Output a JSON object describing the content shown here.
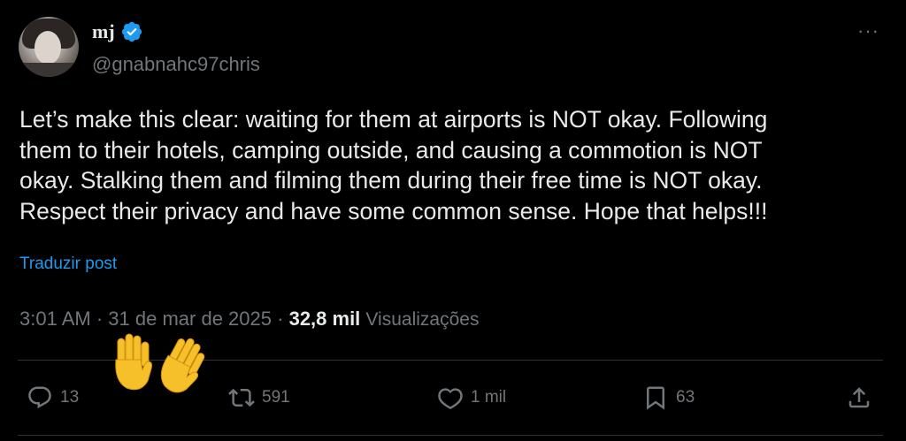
{
  "author": {
    "display_name": "mj",
    "handle": "@gnabnahc97chris",
    "verified": true
  },
  "menu_icon": "more-dots-icon",
  "tweet": {
    "text": "Let’s make this clear: waiting for them at airports is NOT okay. Following\nthem to their hotels, camping outside, and causing a commotion is NOT\nokay. Stalking them and filming them during their free time is NOT okay.\nRespect their privacy and have some common sense. Hope that helps!!!",
    "translate_label": "Traduzir post",
    "time": "3:01 AM",
    "date": "31 de mar de 2025",
    "separator": "·",
    "views_count": "32,8 mil",
    "views_label": "Visualizações"
  },
  "actions": {
    "replies": {
      "icon": "reply-icon",
      "count": "13"
    },
    "reposts": {
      "icon": "repost-icon",
      "count": "591"
    },
    "likes": {
      "icon": "heart-icon",
      "count": "1 mil"
    },
    "bookmarks": {
      "icon": "bookmark-icon",
      "count": "63"
    },
    "share": {
      "icon": "share-icon"
    }
  },
  "overlay": {
    "icon": "waving-hands-emoji"
  },
  "colors": {
    "background": "#000000",
    "text": "#e7e9ea",
    "muted": "#71767b",
    "accent": "#1d9bf0",
    "divider": "#2f3336",
    "emoji": "#f6c02b"
  }
}
